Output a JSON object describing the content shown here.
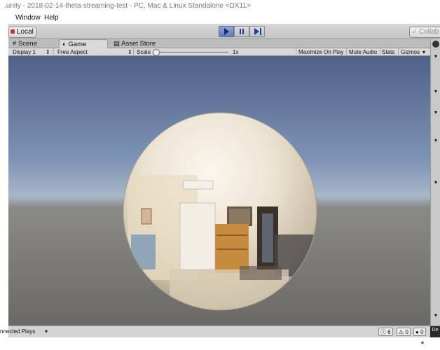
{
  "window": {
    "title": ".unity - 2018-02-14-theta-streaming-test - PC, Mac & Linux Standalone <DX11>"
  },
  "menu": {
    "items": [
      "Window",
      "Help"
    ]
  },
  "toolbar": {
    "local_label": "Local",
    "collab_label": "Collab"
  },
  "tabs": {
    "scene": "Scene",
    "game": "Game",
    "asset_store": "Asset Store"
  },
  "game_bar": {
    "display": "Display 1",
    "aspect": "Free Aspect",
    "scale_label": "Scale",
    "scale_value": "1x",
    "maximize": "Maximize On Play",
    "mute": "Mute Audio",
    "stats": "Stats",
    "gizmos": "Gizmos"
  },
  "status": {
    "left_text": "nnected Plays",
    "info_count": "6",
    "warning_count": "0",
    "error_count": "0"
  },
  "right_panel": {
    "corner_text": "De"
  },
  "colors": {
    "play_accent": "#5e7dbd",
    "sky_top": "#4d6286",
    "ground": "#6b6965"
  }
}
